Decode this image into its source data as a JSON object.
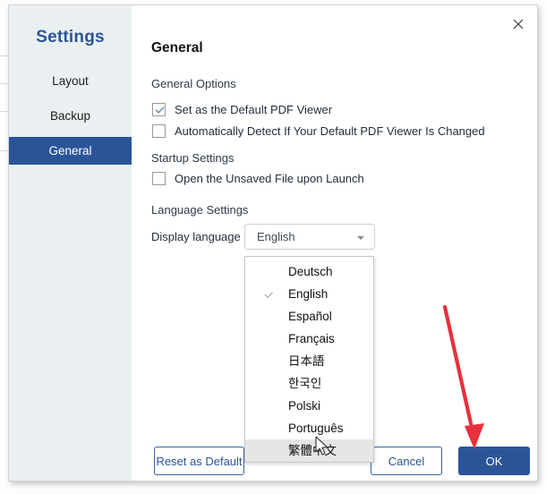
{
  "dialog": {
    "sidebar": {
      "title": "Settings",
      "items": [
        {
          "label": "Layout",
          "selected": false
        },
        {
          "label": "Backup",
          "selected": false
        },
        {
          "label": "General",
          "selected": true
        }
      ]
    },
    "close_icon": "close-icon",
    "page_title": "General",
    "sections": {
      "general_options": {
        "label": "General Options",
        "checkboxes": [
          {
            "label": "Set as the Default PDF Viewer",
            "checked": true
          },
          {
            "label": "Automatically Detect If Your Default PDF Viewer Is Changed",
            "checked": false
          }
        ]
      },
      "startup_settings": {
        "label": "Startup Settings",
        "checkboxes": [
          {
            "label": "Open the Unsaved File upon Launch",
            "checked": false
          }
        ]
      },
      "language_settings": {
        "label": "Language Settings",
        "field_label": "Display language",
        "selected_value": "English",
        "caret_icon": "chevron-down-icon",
        "options": [
          {
            "label": "Deutsch",
            "selected": false,
            "highlighted": false
          },
          {
            "label": "English",
            "selected": true,
            "highlighted": false
          },
          {
            "label": "Español",
            "selected": false,
            "highlighted": false
          },
          {
            "label": "Français",
            "selected": false,
            "highlighted": false
          },
          {
            "label": "日本語",
            "selected": false,
            "highlighted": false
          },
          {
            "label": "한국인",
            "selected": false,
            "highlighted": false
          },
          {
            "label": "Polski",
            "selected": false,
            "highlighted": false
          },
          {
            "label": "Português",
            "selected": false,
            "highlighted": false
          },
          {
            "label": "繁體中文",
            "selected": false,
            "highlighted": true
          }
        ]
      }
    },
    "footer": {
      "reset_label": "Reset as Default",
      "cancel_label": "Cancel",
      "ok_label": "OK"
    }
  },
  "annotation": {
    "arrow_color": "#e8313c",
    "points_to": "OK"
  },
  "colors": {
    "accent_blue": "#2b5498",
    "sidebar_bg": "#eaf0f1",
    "annotation_red": "#e8313c"
  },
  "cursor": {
    "icon": "mouse-pointer-icon"
  }
}
